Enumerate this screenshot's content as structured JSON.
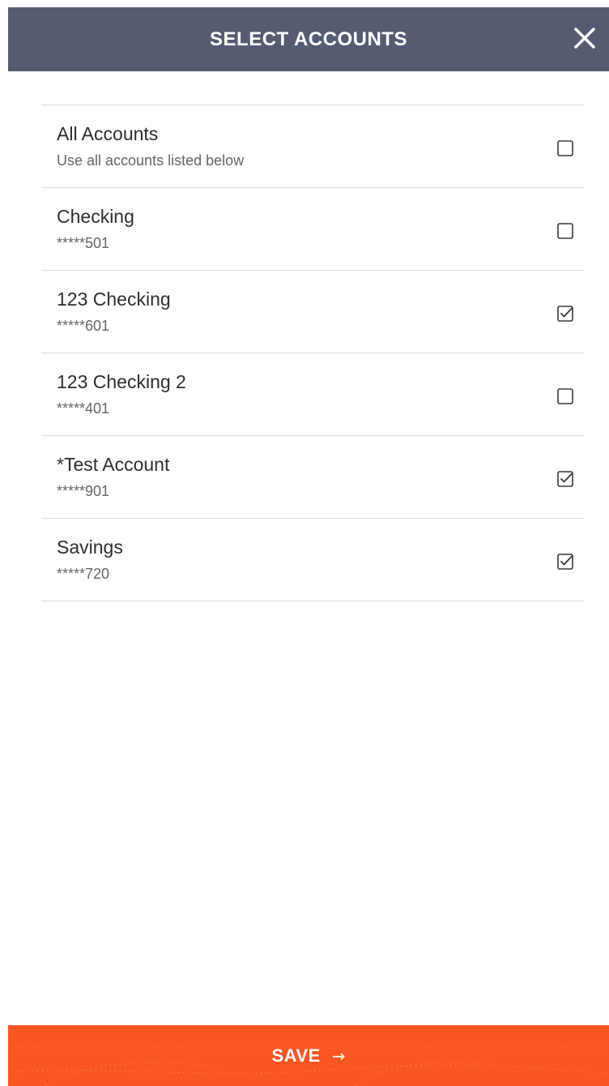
{
  "header": {
    "title": "SELECT ACCOUNTS",
    "close_icon": "close-icon"
  },
  "accounts": [
    {
      "name": "All Accounts",
      "sub": "Use all accounts listed below",
      "checked": false
    },
    {
      "name": "Checking",
      "sub": "*****501",
      "checked": false
    },
    {
      "name": "123 Checking",
      "sub": "*****601",
      "checked": true
    },
    {
      "name": "123 Checking 2",
      "sub": "*****401",
      "checked": false
    },
    {
      "name": "*Test Account",
      "sub": "*****901",
      "checked": true
    },
    {
      "name": "Savings",
      "sub": "*****720",
      "checked": true
    }
  ],
  "footer": {
    "save_label": "SAVE",
    "save_arrow": "→"
  },
  "colors": {
    "header_bg": "#555c72",
    "save_bg": "#fb5621",
    "divider": "#dcdcdc"
  }
}
